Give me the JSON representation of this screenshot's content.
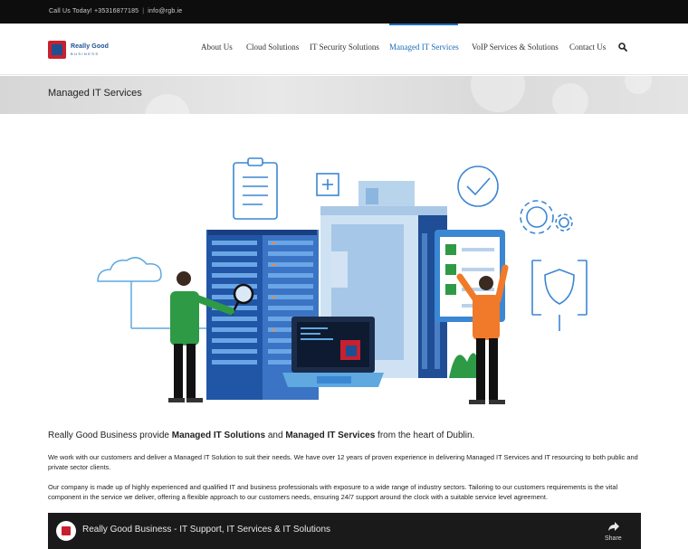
{
  "topbar": {
    "phone": "Call Us Today! +35316877185",
    "separator": "|",
    "email": "info@rgb.ie"
  },
  "logo": {
    "line1": "Really Good",
    "line2": "BUSINESS"
  },
  "nav": {
    "items": [
      {
        "label": "About Us"
      },
      {
        "label": "Cloud Solutions"
      },
      {
        "label": "IT Security Solutions"
      },
      {
        "label": "Managed IT Services"
      },
      {
        "label": "VoIP Services & Solutions"
      },
      {
        "label": "Contact Us"
      }
    ],
    "active_index": 3,
    "search_icon": "search-icon"
  },
  "page": {
    "title": "Managed IT Services"
  },
  "content": {
    "lead_1": "Really Good Business provide ",
    "lead_b1": "Managed IT Solutions",
    "lead_2": " and ",
    "lead_b2": "Managed IT Services",
    "lead_3": " from the heart of Dublin.",
    "para1": "We work with our customers and deliver a Managed IT Solution to suit their needs. We have over 12 years of proven experience in delivering Managed IT Services and IT resourcing to both public and private sector clients.",
    "para2": "Our company is made up of highly experienced and qualified IT and business professionals with exposure to a wide range of industry sectors. Tailoring to our customers requirements is the vital component in the service we deliver, offering a flexible approach to our customers needs, ensuring 24/7 support around the clock with a suitable service level agreement."
  },
  "video": {
    "title": "Really Good Business - IT Support, IT Services & IT Solutions",
    "share_label": "Share"
  },
  "colors": {
    "accent": "#1d6fb8",
    "brand_red": "#c8202f",
    "brand_blue": "#1d4f91",
    "topbar_bg": "#0d0d0d"
  }
}
